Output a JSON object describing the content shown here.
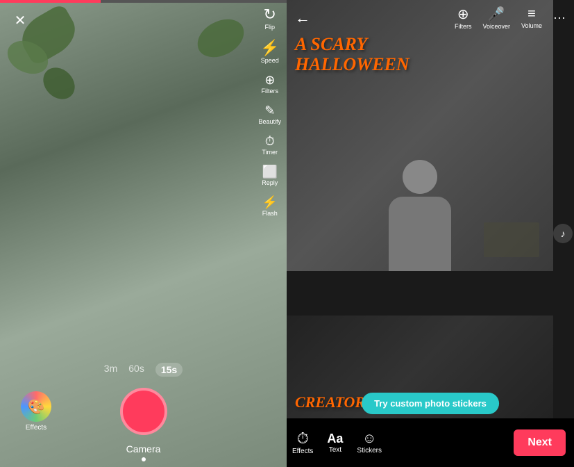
{
  "leftPanel": {
    "progressWidth": "35%",
    "cameraIcons": [
      {
        "id": "flip",
        "symbol": "🔄",
        "label": "Flip"
      },
      {
        "id": "speed",
        "symbol": "⚡",
        "label": "Speed"
      },
      {
        "id": "filters",
        "symbol": "✨",
        "label": "Filters"
      },
      {
        "id": "beautify",
        "symbol": "✏️",
        "label": "Beautify"
      },
      {
        "id": "timer",
        "symbol": "⏱",
        "label": "Timer"
      },
      {
        "id": "reply",
        "symbol": "⬜",
        "label": "Reply"
      },
      {
        "id": "flash",
        "symbol": "⚡",
        "label": "Flash"
      }
    ],
    "durations": [
      {
        "id": "3m",
        "label": "3m",
        "active": false
      },
      {
        "id": "60s",
        "label": "60s",
        "active": false
      },
      {
        "id": "15s",
        "label": "15s",
        "active": true
      }
    ],
    "effectsLabel": "Effects",
    "cameraLabel": "Camera"
  },
  "rightPanel": {
    "halloweenLine1": "A SCARY",
    "halloweenLine2": "HALLOWEEN",
    "creatorEdition": "CREATOR EDITION",
    "stickerBanner": "Try custom photo stickers",
    "toolbar": {
      "items": [
        {
          "id": "effects",
          "symbol": "⏱",
          "label": "Effects"
        },
        {
          "id": "text",
          "symbol": "Aa",
          "label": "Text"
        },
        {
          "id": "stickers",
          "symbol": "☺",
          "label": "Stickers"
        }
      ],
      "nextLabel": "Next"
    },
    "topIcons": [
      {
        "id": "filters",
        "symbol": "✨",
        "label": "Filters"
      },
      {
        "id": "voiceover",
        "symbol": "🎤",
        "label": "Voiceover"
      },
      {
        "id": "volume",
        "symbol": "≡",
        "label": "Volume"
      }
    ]
  }
}
